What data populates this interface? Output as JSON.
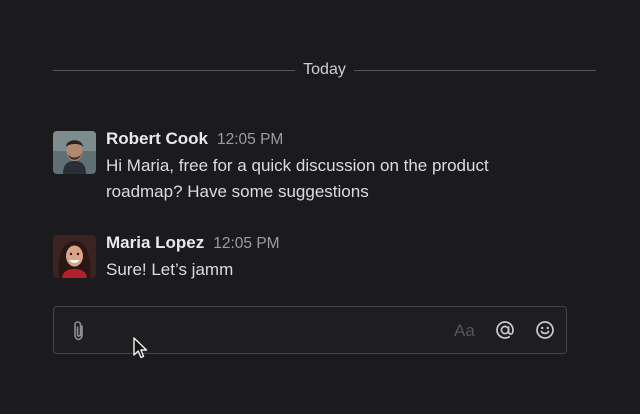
{
  "divider": {
    "label": "Today"
  },
  "messages": [
    {
      "author": "Robert Cook",
      "time": "12:05 PM",
      "text": "Hi Maria, free for a quick discussion on the product roadmap? Have some suggestions"
    },
    {
      "author": "Maria Lopez",
      "time": "12:05 PM",
      "text": "Sure! Let’s jamm"
    }
  ],
  "composer": {
    "placeholder": "",
    "format_label": "Aa",
    "attach_icon": "paperclip-icon",
    "mention_icon": "at-sign-icon",
    "emoji_icon": "smiley-icon"
  },
  "colors": {
    "background": "#1b1b1e",
    "divider_line": "#56565c",
    "timestamp": "#9c9ca3"
  }
}
